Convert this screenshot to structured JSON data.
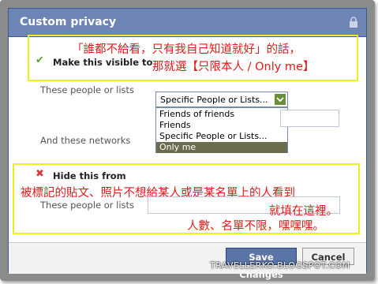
{
  "dialog": {
    "title": "Custom privacy"
  },
  "visible_section": {
    "heading": "Make this visible to",
    "people_label": "These people or lists",
    "networks_label": "And these networks",
    "select_value": "Specific People or Lists...",
    "options": [
      "Friends of friends",
      "Friends",
      "Specific People or Lists...",
      "Only me"
    ],
    "selected_option": "Only me"
  },
  "hide_section": {
    "heading": "Hide this from",
    "people_label": "These people or lists"
  },
  "annotations": {
    "note1_line1": "「誰都不給看，只有我自己知道就好」的話，",
    "note1_line2": "那就選【只限本人 / Only me】",
    "note2_line1": "被標記的貼文、照片不想給某人或是某名單上的人看到",
    "note2_line2": "就填在這裡。",
    "note2_line3": "人數、名單不限，嘿嘿嘿。"
  },
  "buttons": {
    "save": "Save Changes",
    "cancel": "Cancel"
  },
  "watermark": "TRAVELLERKO.BLOGSPOT.COM",
  "colors": {
    "titlebar": "#6d84b4",
    "annotation_red": "#e01919",
    "highlight_yellow": "#f2ee1c"
  }
}
